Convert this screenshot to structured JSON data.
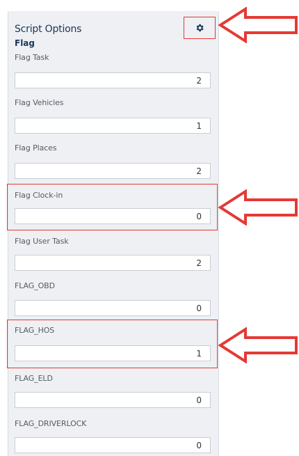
{
  "panel": {
    "title": "Script Options",
    "section": "Flag",
    "settings_icon": "gear-icon",
    "fields": [
      {
        "label": "Flag Task",
        "value": "2"
      },
      {
        "label": "Flag Vehicles",
        "value": "1"
      },
      {
        "label": "Flag Places",
        "value": "2"
      },
      {
        "label": "Flag Clock-in",
        "value": "0"
      },
      {
        "label": "Flag User Task",
        "value": "2"
      },
      {
        "label": "FLAG_OBD",
        "value": "0"
      },
      {
        "label": "FLAG_HOS",
        "value": "1"
      },
      {
        "label": "FLAG_ELD",
        "value": "0"
      },
      {
        "label": "FLAG_DRIVERLOCK",
        "value": "0"
      }
    ]
  },
  "colors": {
    "annotation": "#e53935",
    "panel_bg": "#eef0f4",
    "title_text": "#1c3556"
  }
}
